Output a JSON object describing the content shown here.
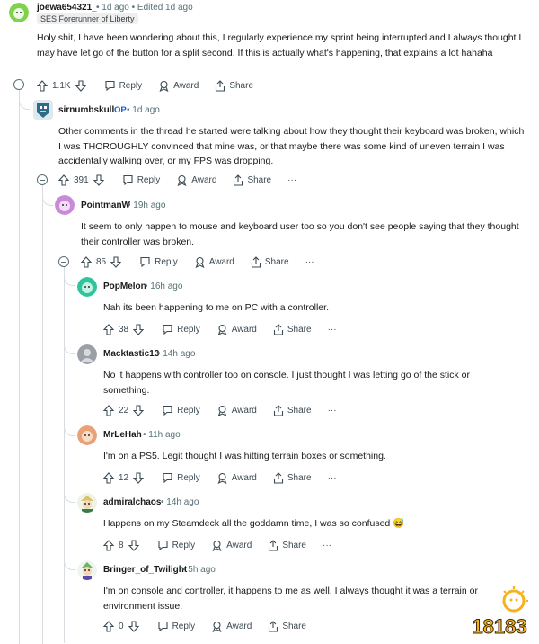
{
  "comments": [
    {
      "username": "joewa654321_",
      "meta": "• 1d ago • Edited 1d ago",
      "flair": "SES Forerunner of Liberty",
      "body": "Holy shit, I have been wondering about this, I regularly experience my sprint being interrupted and I always thought I may have let go of the button for a split second. If this is actually what's happening, that explains a lot hahaha",
      "votes": "1.1K",
      "avatar_color": "#7fd34a"
    },
    {
      "username": "sirnumbskull",
      "badge": "OP",
      "meta": "• 1d ago",
      "body": "Other comments in the thread he started were talking about how they thought their keyboard was broken, which I was THOROUGHLY convinced that mine was, or that maybe there was some kind of uneven terrain I was accidentally walking over, or my FPS was dropping.",
      "votes": "391",
      "avatar_color": "#2e6a8a"
    },
    {
      "username": "PointmanW",
      "meta": "• 19h ago",
      "body": "It seem to only happen to mouse and keyboard user too so you don't see people saying that they thought their controller was broken.",
      "votes": "85",
      "avatar_color": "#c98ad9"
    },
    {
      "username": "PopMelon",
      "meta": "• 16h ago",
      "body": "Nah its been happening to me on PC with a controller.",
      "votes": "38",
      "avatar_color": "#2fc49c"
    },
    {
      "username": "Macktastic13",
      "meta": "• 14h ago",
      "body": "No it happens with controller too on console. I just thought I was letting go of the stick or something.",
      "votes": "22",
      "avatar_color": "#9aa0a6"
    },
    {
      "username": "MrLeHah",
      "meta": "• 11h ago",
      "body": "I'm on a PS5. Legit thought I was hitting terrain boxes or something.",
      "votes": "12",
      "avatar_color": "#e8a276"
    },
    {
      "username": "admiralchaos",
      "meta": "• 14h ago",
      "body": "Happens on my Steamdeck all the goddamn time, I was so confused 😅",
      "votes": "8",
      "avatar_color": "#d9c36a"
    },
    {
      "username": "Bringer_of_Twilight",
      "meta": "• 5h ago",
      "body": "I'm on console and controller, it happens to me as well. I always thought it was a terrain or environment issue.",
      "votes": "0",
      "avatar_color": "#6bb36b"
    }
  ],
  "actions": {
    "reply": "Reply",
    "award": "Award",
    "share": "Share",
    "more": "···"
  },
  "watermark": "18183",
  "colors": {
    "meta_gray": "#576f76",
    "op_blue": "#0a63d1",
    "thread_line": "#d8dce0",
    "logo_yellow": "#f5b21b"
  }
}
